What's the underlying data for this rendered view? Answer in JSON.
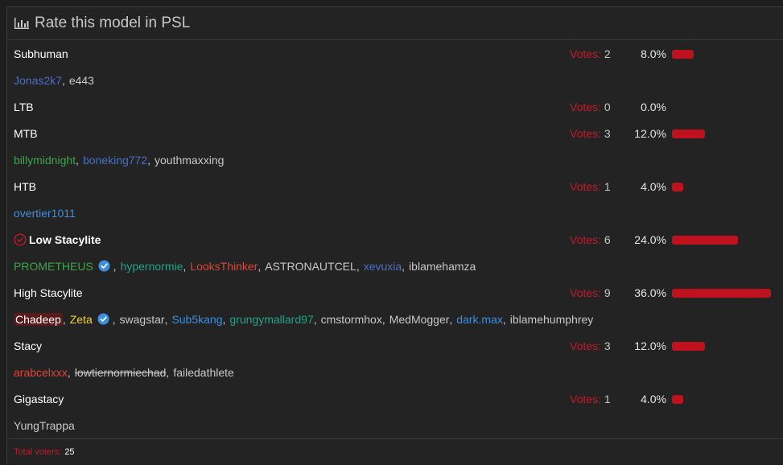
{
  "poll": {
    "title": "Rate this model in PSL",
    "votes_label": "Votes:",
    "total_label": "Total voters:",
    "total": "25",
    "options": [
      {
        "label": "Subhuman",
        "votes": "2",
        "pct": "8.0%",
        "fraction": 0.08,
        "chosen": false,
        "voters": [
          {
            "name": "Jonas2k7",
            "color": "#4a6fc7"
          },
          {
            "name": "e443",
            "color": "#c8c8c8"
          }
        ]
      },
      {
        "label": "LTB",
        "votes": "0",
        "pct": "0.0%",
        "fraction": 0.0,
        "chosen": false,
        "voters": []
      },
      {
        "label": "MTB",
        "votes": "3",
        "pct": "12.0%",
        "fraction": 0.12,
        "chosen": false,
        "voters": [
          {
            "name": "billymidnight",
            "color": "#3fa34d"
          },
          {
            "name": "boneking772",
            "color": "#4a6fc7"
          },
          {
            "name": "youthmaxxing",
            "color": "#c8c8c8"
          }
        ]
      },
      {
        "label": "HTB",
        "votes": "1",
        "pct": "4.0%",
        "fraction": 0.04,
        "chosen": false,
        "voters": [
          {
            "name": "overtier1011",
            "color": "#3d8fe0"
          }
        ]
      },
      {
        "label": "Low Stacylite",
        "votes": "6",
        "pct": "24.0%",
        "fraction": 0.24,
        "chosen": true,
        "voters": [
          {
            "name": "PROMETHEUS",
            "color": "#3fa34d",
            "verified": true
          },
          {
            "name": "hypernormie",
            "color": "#1fa38a"
          },
          {
            "name": "LooksThinker",
            "color": "#e0443a"
          },
          {
            "name": "ASTRONAUTCEL",
            "color": "#c8c8c8"
          },
          {
            "name": "xevuxia",
            "color": "#4a6fc7"
          },
          {
            "name": "iblamehamza",
            "color": "#c8c8c8"
          }
        ]
      },
      {
        "label": "High Stacylite",
        "votes": "9",
        "pct": "36.0%",
        "fraction": 0.36,
        "chosen": false,
        "voters": [
          {
            "name": "Chadeep",
            "color": "#ffffff",
            "highlight": true
          },
          {
            "name": "Zeta",
            "color": "#f0d23a",
            "verified": true
          },
          {
            "name": "swagstar",
            "color": "#c8c8c8"
          },
          {
            "name": "Sub5kang",
            "color": "#3d8fe0"
          },
          {
            "name": "grungymallard97",
            "color": "#1fa38a"
          },
          {
            "name": "cmstormhox",
            "color": "#c8c8c8"
          },
          {
            "name": "MedMogger",
            "color": "#c8c8c8"
          },
          {
            "name": "dark.max",
            "color": "#3d8fe0"
          },
          {
            "name": "iblamehumphrey",
            "color": "#c8c8c8"
          }
        ]
      },
      {
        "label": "Stacy",
        "votes": "3",
        "pct": "12.0%",
        "fraction": 0.12,
        "chosen": false,
        "voters": [
          {
            "name": "arabcelxxx",
            "color": "#e0443a"
          },
          {
            "name": "lowtiernormiechad",
            "color": "#c8c8c8",
            "strike": true
          },
          {
            "name": "failedathlete",
            "color": "#c8c8c8"
          }
        ]
      },
      {
        "label": "Gigastacy",
        "votes": "1",
        "pct": "4.0%",
        "fraction": 0.04,
        "chosen": false,
        "voters": [
          {
            "name": "YungTrappa",
            "color": "#c8c8c8"
          }
        ]
      }
    ]
  }
}
